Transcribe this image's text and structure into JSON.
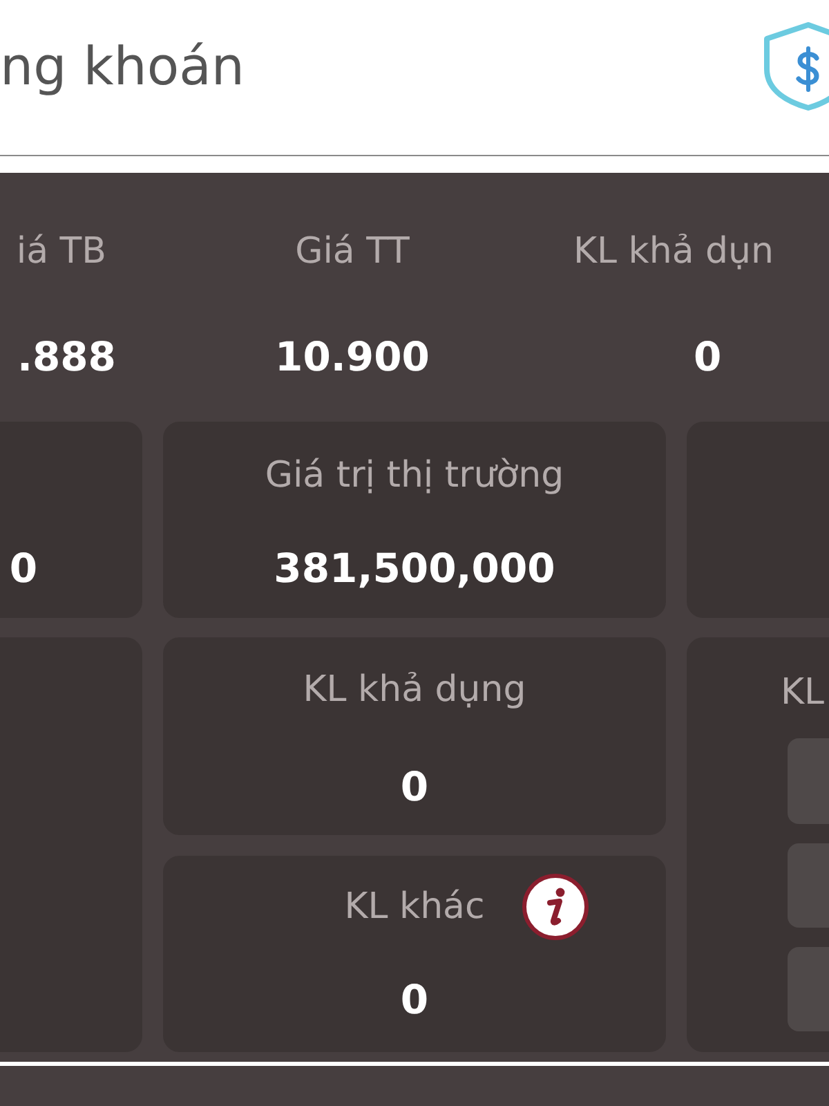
{
  "header": {
    "title": "ng khoán"
  },
  "summary": [
    {
      "label": "iá TB",
      "value": ".888"
    },
    {
      "label": "Giá TT",
      "value": "10.900"
    },
    {
      "label": "KL khả dụn",
      "value": "0"
    }
  ],
  "market_row": {
    "left_card": {
      "value": "0"
    },
    "center_card": {
      "label": "Giá trị thị trường",
      "value": "381,500,000"
    }
  },
  "quantity": {
    "cards": [
      {
        "label": "KL khả dụng",
        "value": "0",
        "info": false
      },
      {
        "label": "KL khác",
        "value": "0",
        "info": true
      }
    ],
    "right_card": {
      "label": "KL"
    }
  }
}
